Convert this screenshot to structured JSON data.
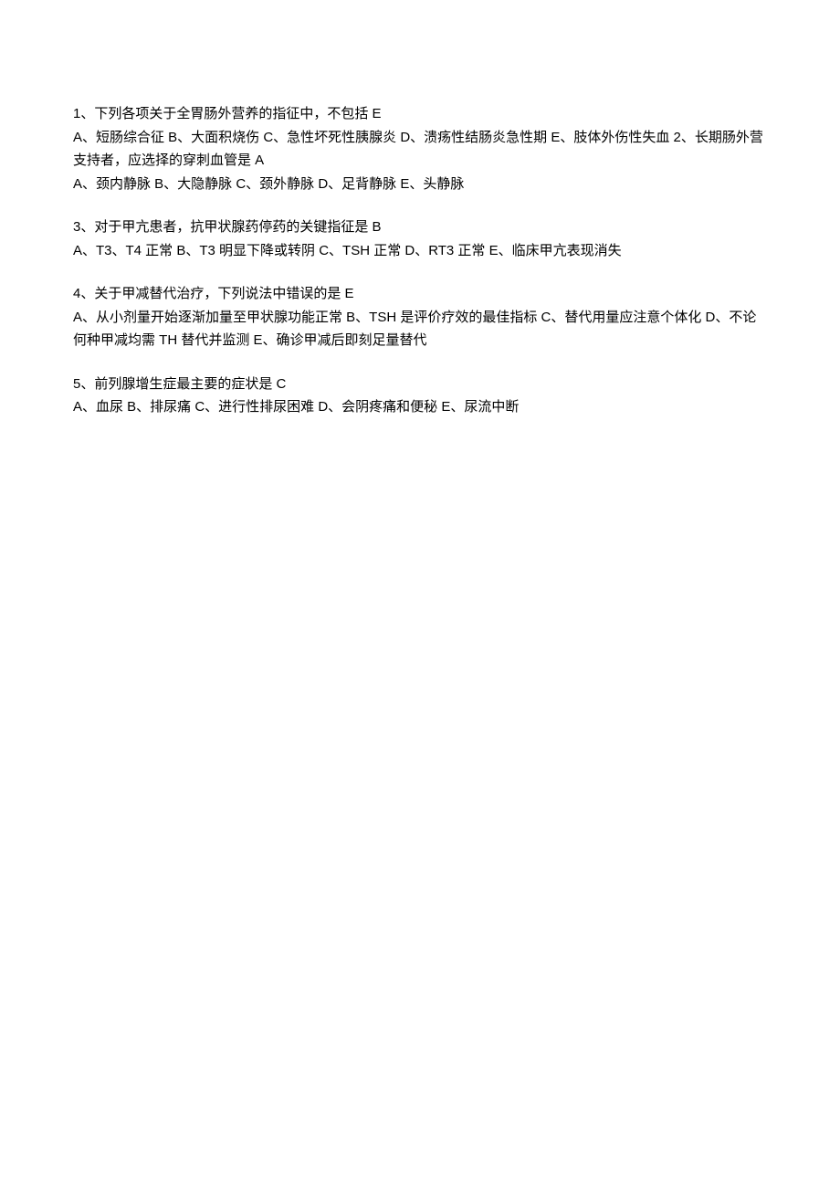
{
  "questions": [
    {
      "stem": "1、下列各项关于全胃肠外营养的指征中，不包括 E",
      "options": "A、短肠综合征 B、大面积烧伤 C、急性坏死性胰腺炎 D、溃疡性结肠炎急性期 E、肢体外伤性失血 2、长期肠外营支持者，应选择的穿刺血管是 A",
      "options2": "A、颈内静脉 B、大隐静脉 C、颈外静脉 D、足背静脉 E、头静脉"
    },
    {
      "stem": "3、对于甲亢患者，抗甲状腺药停药的关键指征是 B",
      "options": "A、T3、T4 正常 B、T3 明显下降或转阴 C、TSH 正常 D、RT3 正常 E、临床甲亢表现消失"
    },
    {
      "stem": "4、关于甲减替代治疗，下列说法中错误的是 E",
      "options": "A、从小剂量开始逐渐加量至甲状腺功能正常 B、TSH 是评价疗效的最佳指标 C、替代用量应注意个体化 D、不论何种甲减均需 TH 替代并监测 E、确诊甲减后即刻足量替代"
    },
    {
      "stem": "5、前列腺增生症最主要的症状是 C",
      "options": "A、血尿 B、排尿痛 C、进行性排尿困难 D、会阴疼痛和便秘 E、尿流中断"
    }
  ]
}
